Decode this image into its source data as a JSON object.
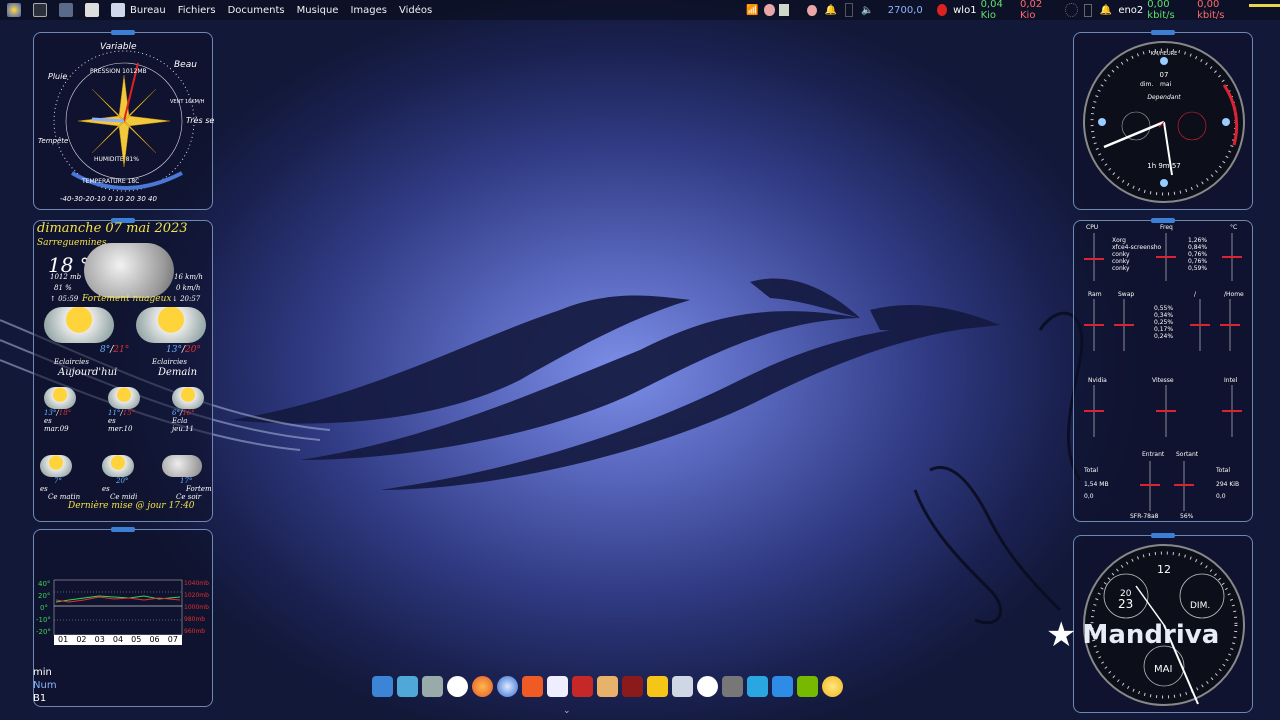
{
  "topbar": {
    "menus": [
      "Bureau",
      "Fichiers",
      "Documents",
      "Musique",
      "Images",
      "Vidéos"
    ],
    "cpu_freq": "2700,0",
    "net1_iface": "wlo1",
    "net1_up": "0,04 Kio",
    "net1_down": "0,02 Kio",
    "net2_iface": "eno2",
    "net2_up": "0,00 kbit/s",
    "net2_down": "0,00 kbit/s"
  },
  "compass": {
    "words": [
      "Variable",
      "Beau",
      "Très sec",
      "Pluie",
      "Tempête"
    ],
    "pressure": "PRESSION 1012MB",
    "humidity": "HUMIDITE 81%",
    "temp": "TEMPERATURE 18C",
    "wind": "VENT 16KM/H",
    "scale": "-40-30-20-10 0 10 20 30 40"
  },
  "weather": {
    "date": "dimanche 07 mai 2023",
    "city": "Sarreguemines",
    "temp": "18 °",
    "cond_now": "Fortement nuageux",
    "pressure": "1012 mb",
    "humidity": "81 %",
    "sunrise": "↑ 05:59",
    "wind": "16 km/h",
    "gust": "0 km/h",
    "sunset": "↓ 20:57",
    "today_lo": "8°",
    "today_hi": "21°",
    "today_cond": "Eclaircies",
    "today_label": "Aujourd'hui",
    "tom_lo": "13°",
    "tom_hi": "20°",
    "tom_cond": "Eclaircies",
    "tom_label": "Demain",
    "days": [
      {
        "lo": "13°",
        "hi": "18°",
        "c": "es",
        "d": "mar.09"
      },
      {
        "lo": "11°",
        "hi": "15°",
        "c": "es",
        "d": "mer.10"
      },
      {
        "lo": "6°",
        "hi": "16°",
        "c": "Ecla",
        "d": "jeu.11"
      }
    ],
    "parts": [
      {
        "t": "7°",
        "c": "es",
        "l": "Ce matin"
      },
      {
        "t": "20°",
        "c": "es",
        "l": "Ce midi"
      },
      {
        "t": "17°",
        "c": "Fortem",
        "l": "Ce soir"
      }
    ],
    "updated": "Dernière mise @ jour  17:40"
  },
  "graph": {
    "ylabels": [
      "40°",
      "20°",
      "0°",
      "-10°",
      "-20°"
    ],
    "rlabels": [
      "1040mb",
      "1020mb",
      "1000mb",
      "980mb",
      "960mb"
    ],
    "days": [
      "01",
      "02",
      "03",
      "04",
      "05",
      "06",
      "07"
    ]
  },
  "kbd": {
    "l1": "min",
    "l2": "Num",
    "l3": "B1"
  },
  "clock": {
    "brand": "Dependant",
    "kmh": "KM/HEURE",
    "day": "dim.",
    "month": "mai",
    "date": "07",
    "uptime": "1h 9m 57"
  },
  "stats": {
    "cpu": "CPU",
    "freq": "Freq",
    "deg": "°C",
    "procs": [
      "Xorg",
      "xfce4-screensho",
      "conky",
      "conky",
      "conky"
    ],
    "pcts": [
      "1,26%",
      "0,84%",
      "0,76%",
      "0,76%",
      "0,59%"
    ],
    "ram": "Ram",
    "swap": "Swap",
    "root": "/",
    "home": "/Home",
    "mpcts": [
      "0,55%",
      "0,34%",
      "0,25%",
      "0,17%",
      "0,24%"
    ],
    "nvidia": "Nvidia",
    "vitesse": "Vitesse",
    "intel": "Intel",
    "entrant": "Entrant",
    "sortant": "Sortant",
    "total": "Total",
    "in_total": "1,54 MB",
    "in_rate": "0,0",
    "out_total": "294 KiB",
    "out_rate": "0,0",
    "ssid": "SFR-78a8",
    "signal": "56%"
  },
  "clock2": {
    "n12": "12",
    "n20": "20",
    "n23": "23",
    "dim": "DIM.",
    "mai": "MAI"
  },
  "logo": "Mandriva",
  "colors": {
    "accent": "#3d7fd4",
    "panel_border": "#6f87b3",
    "yellow": "#f2e24a",
    "red": "#e03030",
    "green": "#39d353"
  }
}
